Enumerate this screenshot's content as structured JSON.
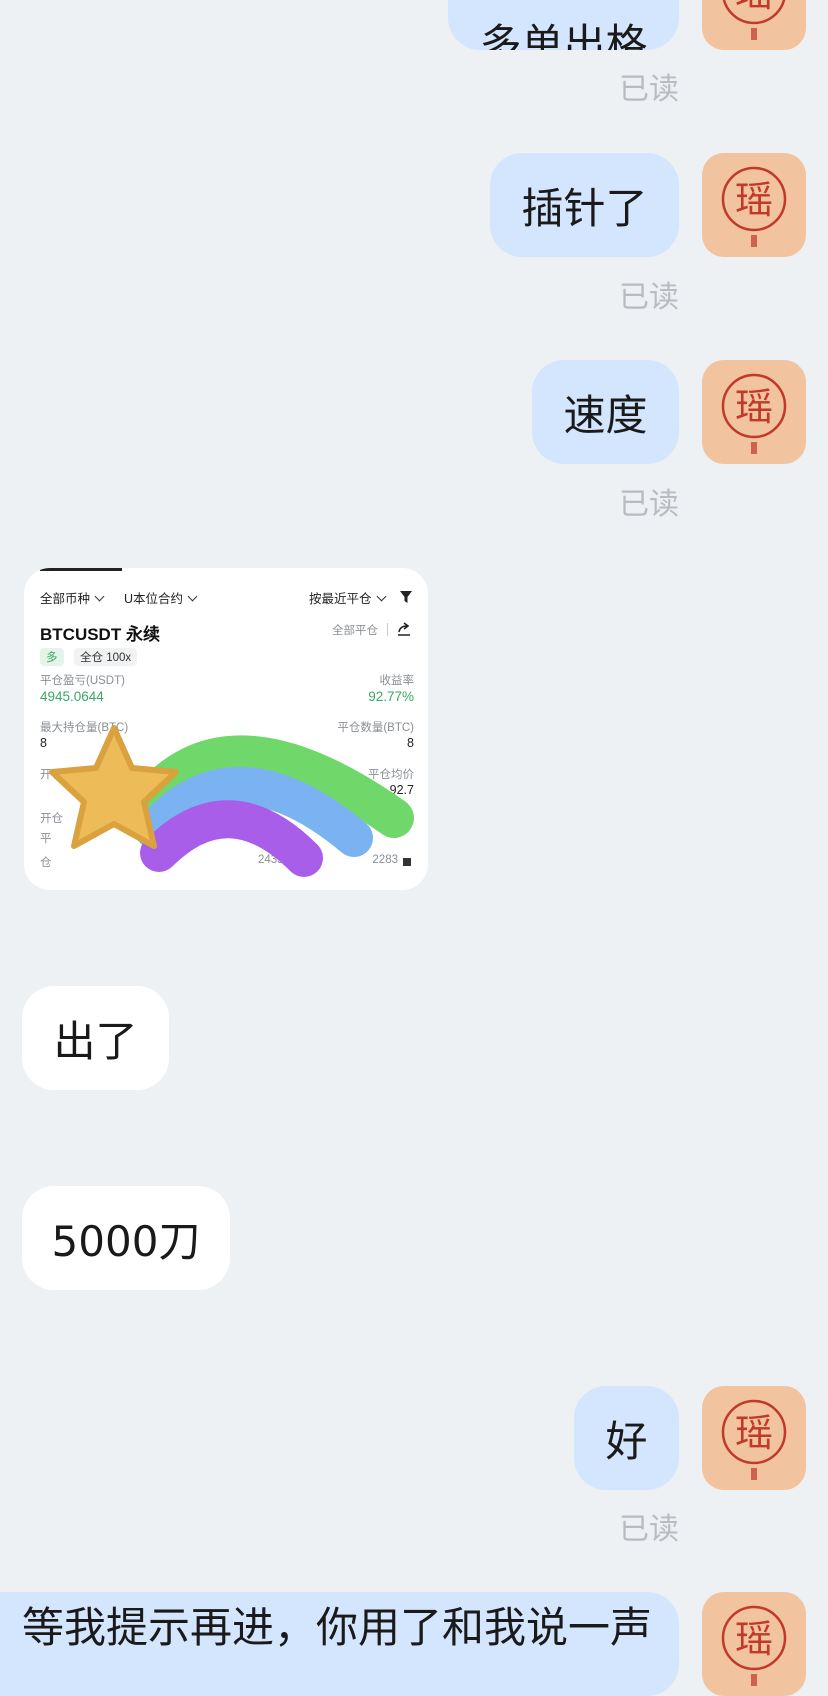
{
  "messages": {
    "m1_text": "多单出格",
    "m2_text": "插针了",
    "m3_text": "速度",
    "m4_text": "出了",
    "m5_text": "5000刀",
    "m6_text": "好",
    "m7_text": "等我提示再进，你用了和我说一声",
    "read_label": "已读"
  },
  "avatar": {
    "char": "瑶",
    "bg": "#f1c39e",
    "ink": "#c0392b"
  },
  "screenshot": {
    "filter_all": "全部币种",
    "filter_contract": "U本位合约",
    "sort_label": "按最近平仓",
    "pair": "BTCUSDT 永续",
    "close_all": "全部平仓",
    "side_tag": "多",
    "margin_tag": "全仓 100x",
    "pnl_label": "平仓盈亏(USDT)",
    "pnl_value": "4945.0644",
    "roi_label": "收益率",
    "roi_value": "92.77%",
    "max_pos_label": "最大持仓量(BTC)",
    "max_pos_value": "8",
    "close_qty_label": "平仓数量(BTC)",
    "close_qty_value": "8",
    "row3_left": "开仓均价",
    "row3_right_label": "平仓均价",
    "row3_right_value": "92.7",
    "row4_left": "开仓",
    "row5_left": "平",
    "row6_left": "仓",
    "row6_mid": "2435",
    "row6_right": "2283"
  },
  "colors": {
    "me_bubble": "#d4e5fe",
    "them_bubble": "#ffffff",
    "bg": "#eef1f4",
    "green": "#3aa861"
  }
}
